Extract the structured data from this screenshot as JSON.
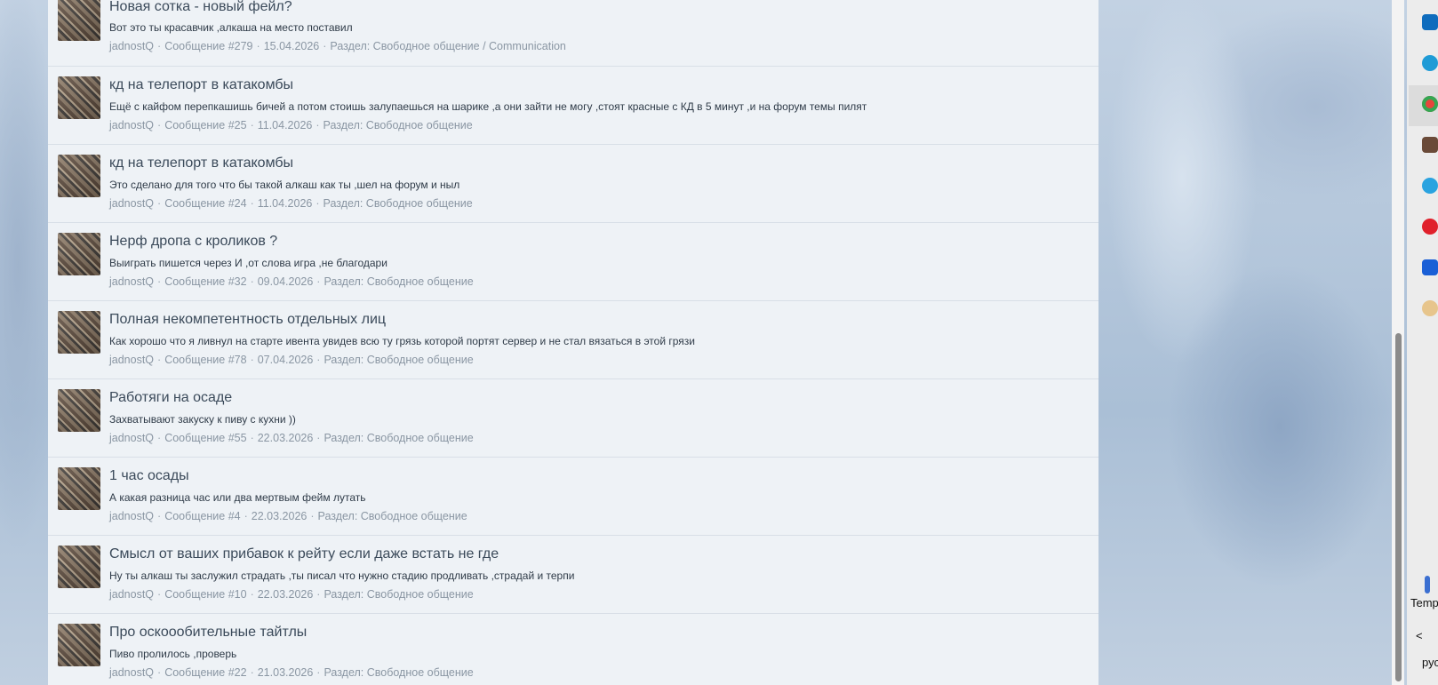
{
  "posts": [
    {
      "title": "Новая сотка - новый фейл?",
      "snippet": "Вот это ты красавчик ,алкаша на место поставил",
      "author": "jadnostQ",
      "message": "Сообщение #279",
      "date": "15.04.2026",
      "section": "Раздел: Свободное общение / Communication"
    },
    {
      "title": "кд на телепорт в катакомбы",
      "snippet": "Ещё с кайфом перепкашишь бичей а потом стоишь залупаешься на шарике ,а они зайти не могу ,стоят красные с КД в 5 минут ,и на форум темы пилят",
      "author": "jadnostQ",
      "message": "Сообщение #25",
      "date": "11.04.2026",
      "section": "Раздел: Свободное общение"
    },
    {
      "title": "кд на телепорт в катакомбы",
      "snippet": "Это сделано для того что бы такой алкаш как ты ,шел на форум и ныл",
      "author": "jadnostQ",
      "message": "Сообщение #24",
      "date": "11.04.2026",
      "section": "Раздел: Свободное общение"
    },
    {
      "title": "Нерф дропа с кроликов ?",
      "snippet": "Выиграть пишется через И ,от слова игра ,не благодари",
      "author": "jadnostQ",
      "message": "Сообщение #32",
      "date": "09.04.2026",
      "section": "Раздел: Свободное общение"
    },
    {
      "title": "Полная некомпетентность отдельных лиц",
      "snippet": "Как хорошо что я ливнул на старте ивента увидев всю ту грязь которой портят сервер и не стал вязаться в этой грязи",
      "author": "jadnostQ",
      "message": "Сообщение #78",
      "date": "07.04.2026",
      "section": "Раздел: Свободное общение"
    },
    {
      "title": "Работяги на осаде",
      "snippet": "Захватывают закуску к пиву с кухни ))",
      "author": "jadnostQ",
      "message": "Сообщение #55",
      "date": "22.03.2026",
      "section": "Раздел: Свободное общение"
    },
    {
      "title": "1 час осады",
      "snippet": "А какая разница час или два мертвым фейм лутать",
      "author": "jadnostQ",
      "message": "Сообщение #4",
      "date": "22.03.2026",
      "section": "Раздел: Свободное общение"
    },
    {
      "title": "Смысл от ваших прибавок к рейту если даже встать не где",
      "snippet": "Ну ты алкаш ты заслужил страдать ,ты писал что нужно стадию продливать ,страдай и терпи",
      "author": "jadnostQ",
      "message": "Сообщение #10",
      "date": "22.03.2026",
      "section": "Раздел: Свободное общение"
    },
    {
      "title": "Про оскоообительные тайтлы",
      "snippet": "Пиво пролилось ,проверь",
      "author": "jadnostQ",
      "message": "Сообщение #22",
      "date": "21.03.2026",
      "section": "Раздел: Свободное общение"
    }
  ],
  "taskbar": {
    "temp_label": "Temp",
    "lang_label": "рус",
    "chevron": "<"
  },
  "colors": {
    "panel_bg": "#eef2f6",
    "title": "#3b4a5a",
    "meta": "#8a96a3"
  }
}
